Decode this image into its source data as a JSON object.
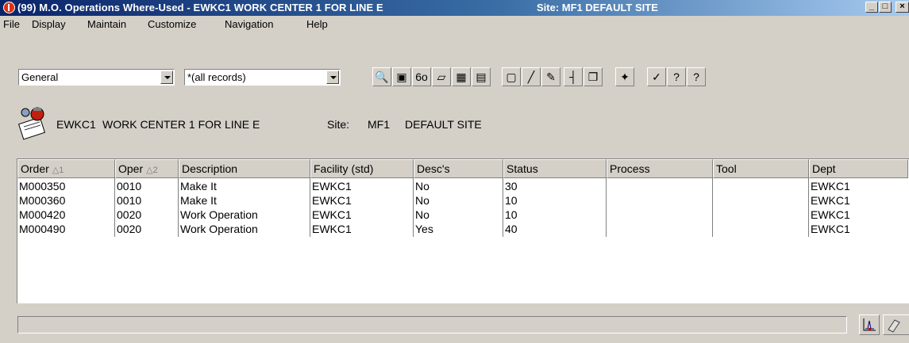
{
  "window": {
    "title": "(99) M.O. Operations Where-Used - EWKC1   WORK CENTER 1 FOR LINE E",
    "site": "Site:  MF1   DEFAULT SITE",
    "minimize": "_",
    "maximize": "□",
    "close": "×"
  },
  "menu": [
    "File",
    "Display",
    "Maintain",
    "Customize",
    "Navigation",
    "Help"
  ],
  "toolbar": {
    "view_select": "General",
    "filter_select": "*(all records)",
    "buttons": [
      {
        "name": "find-binoculars-icon",
        "glyph": "🔍"
      },
      {
        "name": "zoom-icon",
        "glyph": "▣"
      },
      {
        "name": "glasses-icon",
        "glyph": "6o"
      },
      {
        "name": "note-icon",
        "glyph": "▱"
      },
      {
        "name": "print-icon",
        "glyph": "▦"
      },
      {
        "name": "printer-icon",
        "glyph": "▤"
      },
      {
        "name": "new-document-icon",
        "glyph": "▢"
      },
      {
        "name": "edit-pencil-icon",
        "glyph": "╱"
      },
      {
        "name": "edit-line-icon",
        "glyph": "✎"
      },
      {
        "name": "hierarchy-icon",
        "glyph": "┤"
      },
      {
        "name": "copy-icon",
        "glyph": "❐"
      },
      {
        "name": "wizard-icon",
        "glyph": "✦"
      },
      {
        "name": "pushpin-icon",
        "glyph": "✓"
      },
      {
        "name": "binary-icon-1",
        "glyph": "?"
      },
      {
        "name": "binary-icon-2",
        "glyph": "?"
      }
    ]
  },
  "header": {
    "code": "EWKC1",
    "description": "WORK CENTER 1 FOR LINE E",
    "site_label": "Site:",
    "site_code": "MF1",
    "site_name": "DEFAULT SITE"
  },
  "grid": {
    "columns": [
      {
        "label": "Order",
        "sort": "△1"
      },
      {
        "label": "Oper",
        "sort": "△2"
      },
      {
        "label": "Description",
        "sort": ""
      },
      {
        "label": "Facility (std)",
        "sort": ""
      },
      {
        "label": "Desc's",
        "sort": ""
      },
      {
        "label": "Status",
        "sort": ""
      },
      {
        "label": "Process",
        "sort": ""
      },
      {
        "label": "Tool",
        "sort": ""
      },
      {
        "label": "Dept",
        "sort": ""
      }
    ],
    "rows": [
      [
        "M000350",
        "0010",
        "Make It",
        "EWKC1",
        "No",
        "30",
        "",
        "",
        "EWKC1"
      ],
      [
        "M000360",
        "0010",
        "Make It",
        "EWKC1",
        "No",
        "10",
        "",
        "",
        "EWKC1"
      ],
      [
        "M000420",
        "0020",
        "Work Operation",
        "EWKC1",
        "No",
        "10",
        "",
        "",
        "EWKC1"
      ],
      [
        "M000490",
        "0020",
        "Work Operation",
        "EWKC1",
        "Yes",
        "40",
        "",
        "",
        "EWKC1"
      ]
    ]
  },
  "statusbar": {
    "text": "",
    "buttons": [
      "chart-icon",
      "eraser-icon"
    ]
  },
  "colors": {
    "titlebar_start": "#0a246a",
    "titlebar_end": "#a6caf0",
    "face": "#d4d0c8"
  }
}
